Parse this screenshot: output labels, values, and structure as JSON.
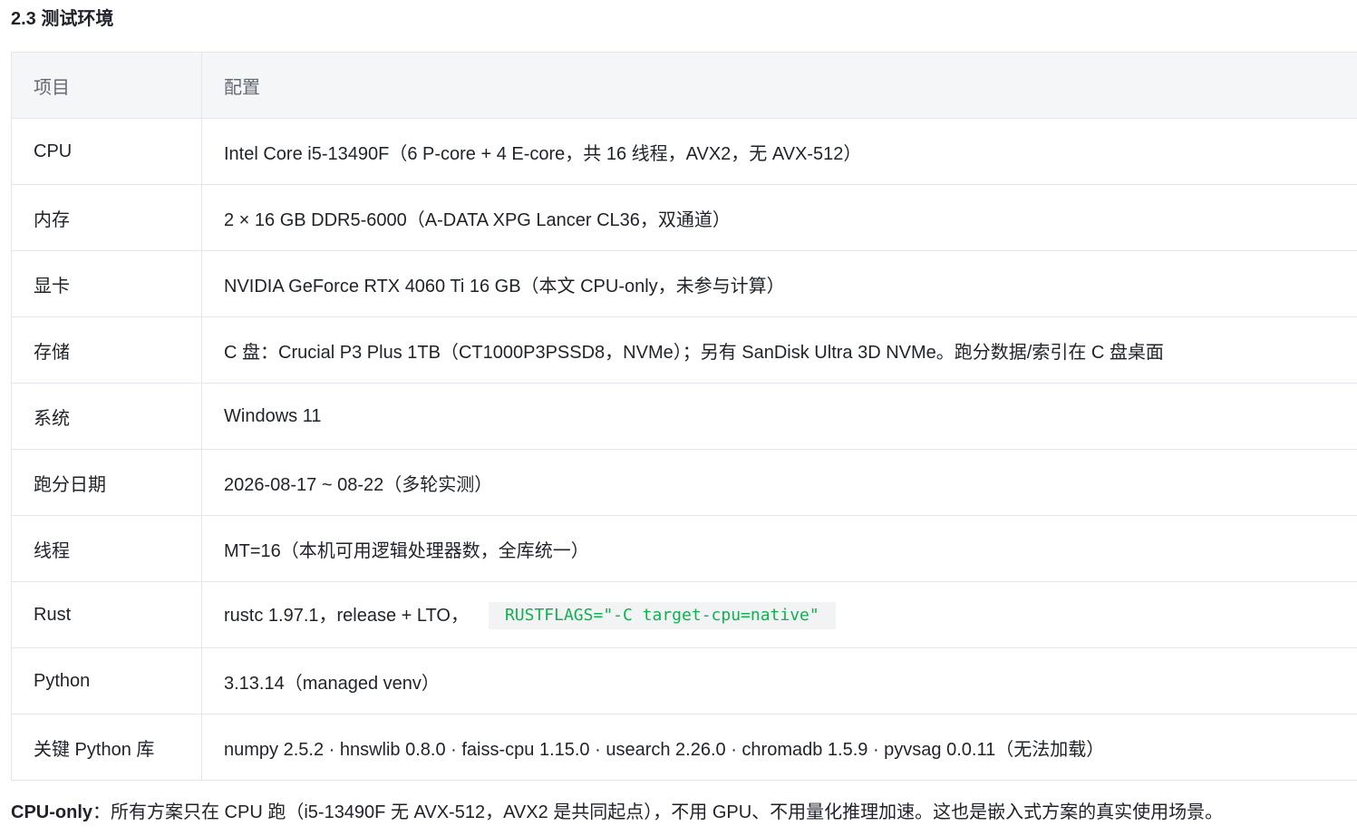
{
  "section": {
    "title": "2.3 测试环境"
  },
  "table": {
    "headers": [
      "项目",
      "配置"
    ],
    "rows": [
      {
        "item": "CPU",
        "config": "Intel Core i5-13490F（6 P-core + 4 E-core，共 16 线程，AVX2，无 AVX-512）"
      },
      {
        "item": "内存",
        "config": "2 × 16 GB DDR5-6000（A-DATA XPG Lancer CL36，双通道）"
      },
      {
        "item": "显卡",
        "config": "NVIDIA GeForce RTX 4060 Ti 16 GB（本文 CPU-only，未参与计算）"
      },
      {
        "item": "存储",
        "config": "C 盘：Crucial P3 Plus 1TB（CT1000P3PSSD8，NVMe）；另有 SanDisk Ultra 3D NVMe。跑分数据/索引在 C 盘桌面"
      },
      {
        "item": "系统",
        "config": "Windows 11"
      },
      {
        "item": "跑分日期",
        "config": "2026-08-17 ~ 08-22（多轮实测）"
      },
      {
        "item": "线程",
        "config": "MT=16（本机可用逻辑处理器数，全库统一）"
      },
      {
        "item": "Rust",
        "config": "rustc 1.97.1，release + LTO，",
        "code": "RUSTFLAGS=\"-C target-cpu=native\""
      },
      {
        "item": "Python",
        "config": "3.13.14（managed venv）"
      },
      {
        "item": "关键 Python 库",
        "config": "numpy 2.5.2 · hnswlib 0.8.0 · faiss-cpu 1.15.0 · usearch 2.26.0 · chromadb 1.5.9 · pyvsag 0.0.11（无法加载）"
      }
    ]
  },
  "note": {
    "label": "CPU-only",
    "text": "：所有方案只在 CPU 跑（i5-13490F 无 AVX-512，AVX2 是共同起点），不用 GPU、不用量化推理加速。这也是嵌入式方案的真实使用场景。"
  },
  "colors": {
    "text": "#1f2329",
    "header_text": "#646a73",
    "header_bg": "#f5f6f7",
    "border": "#e5e6eb",
    "code_bg": "#f2f3f5",
    "code_text": "#10b14f"
  }
}
